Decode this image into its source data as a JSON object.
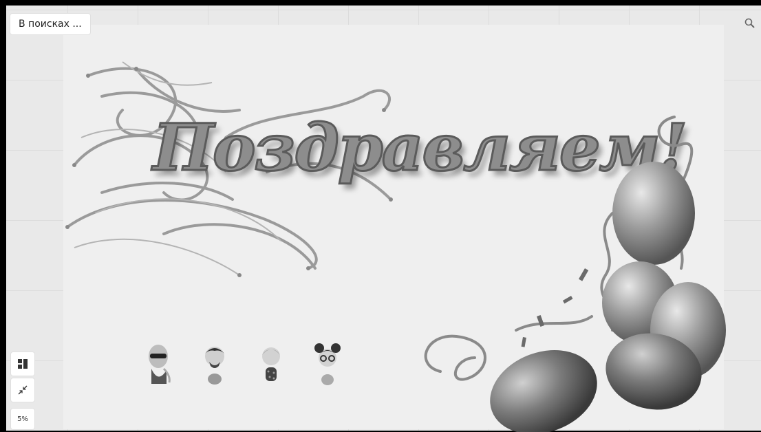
{
  "search": {
    "value": "В поисках ..."
  },
  "board": {
    "title_text": "Поздравляем!"
  },
  "toolbar": {
    "zoom_label": "5%"
  },
  "avatars": [
    {
      "name": "avatar-sunglasses"
    },
    {
      "name": "avatar-man-beard"
    },
    {
      "name": "avatar-girl-dots"
    },
    {
      "name": "avatar-girl-glasses"
    }
  ],
  "icons": {
    "search": "magnifier-icon",
    "layout": "layout-icon",
    "collapse": "collapse-arrows-icon"
  }
}
